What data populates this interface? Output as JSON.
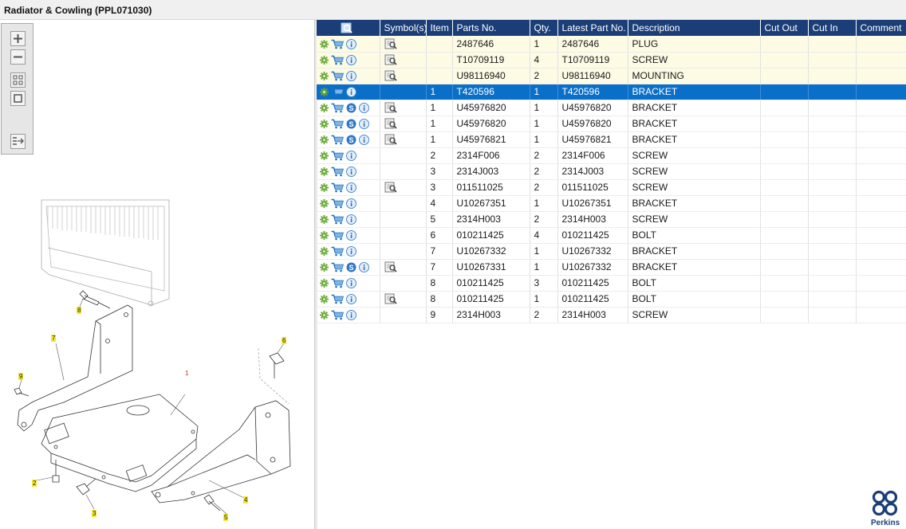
{
  "window": {
    "title": "Radiator & Cowling (PPL071030)"
  },
  "toolbar": {
    "buttons": [
      {
        "name": "zoom-in",
        "icon": "plus-icon"
      },
      {
        "name": "zoom-out",
        "icon": "minus-icon"
      },
      {
        "name": "fit-all",
        "icon": "grid-icon"
      },
      {
        "name": "actual-size",
        "icon": "square-icon"
      },
      {
        "name": "export",
        "icon": "list-arrow-icon"
      }
    ]
  },
  "drawing": {
    "callouts": [
      "1",
      "2",
      "3",
      "4",
      "5",
      "6",
      "7",
      "8",
      "9"
    ]
  },
  "table": {
    "columns": [
      "",
      "Symbol(s)",
      "Item",
      "Parts No.",
      "Qty.",
      "Latest Part No.",
      "Description",
      "Cut Out",
      "Cut In",
      "Comment"
    ],
    "rows": [
      {
        "item": "",
        "part": "2487646",
        "qty": "1",
        "latest": "2487646",
        "desc": "PLUG",
        "s": false,
        "sym": true,
        "state": "hl"
      },
      {
        "item": "",
        "part": "T10709119",
        "qty": "4",
        "latest": "T10709119",
        "desc": "SCREW",
        "s": false,
        "sym": true,
        "state": "hl"
      },
      {
        "item": "",
        "part": "U98116940",
        "qty": "2",
        "latest": "U98116940",
        "desc": "MOUNTING",
        "s": false,
        "sym": true,
        "state": "hl"
      },
      {
        "item": "1",
        "part": "T420596",
        "qty": "1",
        "latest": "T420596",
        "desc": "BRACKET",
        "s": false,
        "sym": false,
        "state": "sel"
      },
      {
        "item": "1",
        "part": "U45976820",
        "qty": "1",
        "latest": "U45976820",
        "desc": "BRACKET",
        "s": true,
        "sym": true,
        "state": ""
      },
      {
        "item": "1",
        "part": "U45976820",
        "qty": "1",
        "latest": "U45976820",
        "desc": "BRACKET",
        "s": true,
        "sym": true,
        "state": ""
      },
      {
        "item": "1",
        "part": "U45976821",
        "qty": "1",
        "latest": "U45976821",
        "desc": "BRACKET",
        "s": true,
        "sym": true,
        "state": ""
      },
      {
        "item": "2",
        "part": "2314F006",
        "qty": "2",
        "latest": "2314F006",
        "desc": "SCREW",
        "s": false,
        "sym": false,
        "state": ""
      },
      {
        "item": "3",
        "part": "2314J003",
        "qty": "2",
        "latest": "2314J003",
        "desc": "SCREW",
        "s": false,
        "sym": false,
        "state": ""
      },
      {
        "item": "3",
        "part": "011511025",
        "qty": "2",
        "latest": "011511025",
        "desc": "SCREW",
        "s": false,
        "sym": true,
        "state": ""
      },
      {
        "item": "4",
        "part": "U10267351",
        "qty": "1",
        "latest": "U10267351",
        "desc": "BRACKET",
        "s": false,
        "sym": false,
        "state": ""
      },
      {
        "item": "5",
        "part": "2314H003",
        "qty": "2",
        "latest": "2314H003",
        "desc": "SCREW",
        "s": false,
        "sym": false,
        "state": ""
      },
      {
        "item": "6",
        "part": "010211425",
        "qty": "4",
        "latest": "010211425",
        "desc": "BOLT",
        "s": false,
        "sym": false,
        "state": ""
      },
      {
        "item": "7",
        "part": "U10267332",
        "qty": "1",
        "latest": "U10267332",
        "desc": "BRACKET",
        "s": false,
        "sym": false,
        "state": ""
      },
      {
        "item": "7",
        "part": "U10267331",
        "qty": "1",
        "latest": "U10267332",
        "desc": "BRACKET",
        "s": true,
        "sym": true,
        "state": ""
      },
      {
        "item": "8",
        "part": "010211425",
        "qty": "3",
        "latest": "010211425",
        "desc": "BOLT",
        "s": false,
        "sym": false,
        "state": ""
      },
      {
        "item": "8",
        "part": "010211425",
        "qty": "1",
        "latest": "010211425",
        "desc": "BOLT",
        "s": false,
        "sym": true,
        "state": ""
      },
      {
        "item": "9",
        "part": "2314H003",
        "qty": "2",
        "latest": "2314H003",
        "desc": "SCREW",
        "s": false,
        "sym": false,
        "state": ""
      }
    ]
  },
  "brand": {
    "name": "Perkins",
    "color": "#1b3e78"
  },
  "colors": {
    "header": "#1b3e78",
    "selected": "#0a6fc8",
    "highlight": "#fdfbe4",
    "gear": "#6aa832",
    "cart": "#1b6fc0"
  }
}
